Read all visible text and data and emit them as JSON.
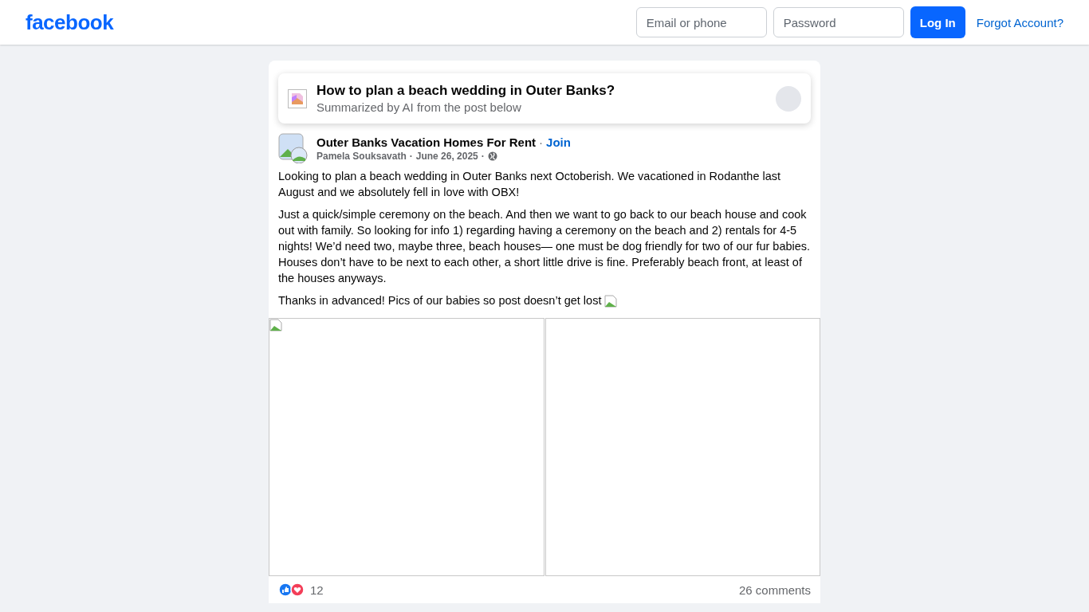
{
  "header": {
    "logo": "facebook",
    "email": {
      "placeholder": "Email or phone"
    },
    "password": {
      "placeholder": "Password"
    },
    "login_button": "Log In",
    "forgot_link": "Forgot Account?"
  },
  "summary": {
    "title": "How to plan a beach wedding in Outer Banks?",
    "subtitle": "Summarized by AI from the post below"
  },
  "post": {
    "group": "Outer Banks Vacation Homes For Rent",
    "join": "Join",
    "author": "Pamela Souksavath",
    "date": "June 26, 2025",
    "paragraphs": [
      "Looking to plan a beach wedding in Outer Banks next Octoberish. We vacationed in Rodanthe last August and we absolutely fell in love with OBX!",
      "Just a quick/simple ceremony on the beach. And then we want to go back to our beach house and cook out with family. So looking for info 1) regarding having a ceremony on the beach and 2) rentals for 4-5 nights! We’d need two, maybe three, beach houses— one must be dog friendly for two of our fur babies. Houses don’t have to be next to each other, a short little drive is fine. Preferably beach front, at least of the houses anyways.",
      "Thanks in advanced! Pics of our babies so post doesn’t get lost"
    ],
    "separator": "·",
    "reactions": "12",
    "comments": "26 comments"
  }
}
